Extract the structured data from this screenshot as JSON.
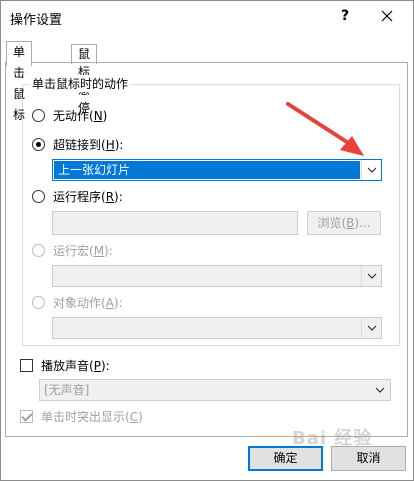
{
  "dialog": {
    "title": "操作设置",
    "help_glyph": "?",
    "close_glyph": "✕"
  },
  "tabs": [
    {
      "label": "单击鼠标",
      "active": true
    },
    {
      "label": "鼠标悬停",
      "active": false
    }
  ],
  "group": {
    "title": "单击鼠标时的动作"
  },
  "options": {
    "none": {
      "label": "无动作(",
      "key": "N",
      "end": ")",
      "checked": false
    },
    "hyperlink": {
      "label": "超链接到(",
      "key": "H",
      "end": "):",
      "checked": true,
      "value": "上一张幻灯片"
    },
    "run_program": {
      "label": "运行程序(",
      "key": "R",
      "end": "):",
      "checked": false,
      "browse_label": "浏览(",
      "browse_key": "B",
      "browse_end": ")..."
    },
    "run_macro": {
      "label": "运行宏(",
      "key": "M",
      "end": "):",
      "checked": false,
      "disabled": true
    },
    "object_action": {
      "label": "对象动作(",
      "key": "A",
      "end": "):",
      "checked": false,
      "disabled": true
    }
  },
  "sound": {
    "label": "播放声音(",
    "key": "P",
    "end": "):",
    "checked": false,
    "value": "[无声音]"
  },
  "highlight": {
    "label": "单击时突出显示(",
    "key": "C",
    "end": ")",
    "checked": true,
    "disabled": true
  },
  "buttons": {
    "ok": "确定",
    "cancel": "取消"
  },
  "watermark": "Bai 经验",
  "colors": {
    "accent": "#0078d7",
    "arrow": "#e8413a"
  },
  "icons": {
    "dropdown": "chevron-down-icon",
    "annotation": "red-arrow"
  }
}
